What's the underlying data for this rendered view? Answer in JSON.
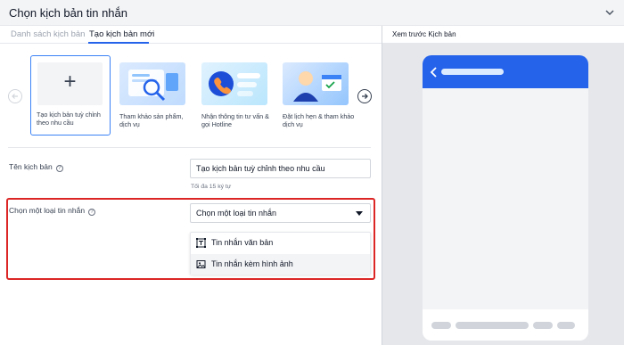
{
  "header": {
    "title": "Chọn kịch bản tin nhắn",
    "chevron_icon": "chevron-down-icon"
  },
  "tabs": [
    {
      "label": "Danh sách kịch bản",
      "active": false
    },
    {
      "label": "Tạo kịch bản mới",
      "active": true
    }
  ],
  "templates": [
    {
      "label": "Tạo kịch bản tuỳ chỉnh theo nhu cầu",
      "icon": "plus-icon",
      "selected": true
    },
    {
      "label": "Tham khảo sản phẩm, dịch vụ",
      "icon": "product-browse-illustration",
      "selected": false
    },
    {
      "label": "Nhận thông tin tư vấn & gọi Hotline",
      "icon": "phone-call-illustration",
      "selected": false
    },
    {
      "label": "Đặt lịch hẹn & tham khảo dịch vụ",
      "icon": "appointment-illustration",
      "selected": false
    }
  ],
  "form": {
    "name_label": "Tên kịch bản",
    "name_value": "Tạo kịch bản tuỳ chỉnh theo nhu cầu",
    "name_hint": "Tối đa 15 ký tự",
    "type_label": "Chọn một loại tin nhắn",
    "type_placeholder": "Chọn một loại tin nhắn",
    "type_options": [
      {
        "label": "Tin nhắn văn bản",
        "icon": "text-message-icon"
      },
      {
        "label": "Tin nhắn kèm hình ảnh",
        "icon": "image-message-icon"
      }
    ]
  },
  "preview": {
    "title": "Xem trước Kịch bản"
  },
  "colors": {
    "accent": "#2563eb",
    "highlight": "#dc2626",
    "panel_bg": "#e5e7eb"
  }
}
